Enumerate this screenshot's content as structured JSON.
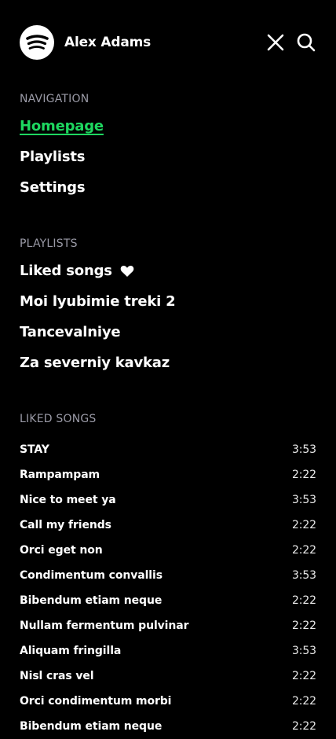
{
  "header": {
    "username": "Alex Adams",
    "logo_icon": "spotify-logo",
    "close_icon": "close-icon",
    "search_icon": "search-icon"
  },
  "navigation": {
    "label": "NAVIGATION",
    "items": [
      {
        "label": "Homepage",
        "active": true
      },
      {
        "label": "Playlists",
        "active": false
      },
      {
        "label": "Settings",
        "active": false
      }
    ]
  },
  "playlists": {
    "label": "PLAYLISTS",
    "items": [
      {
        "label": "Liked songs",
        "icon": "heart-icon"
      },
      {
        "label": "Moi lyubimie treki 2"
      },
      {
        "label": "Tancevalniye"
      },
      {
        "label": "Za severniy kavkaz"
      }
    ]
  },
  "liked_songs": {
    "label": "LIKED SONGS",
    "songs": [
      {
        "title": "STAY",
        "duration": "3:53"
      },
      {
        "title": "Rampampam",
        "duration": "2:22"
      },
      {
        "title": "Nice to meet ya",
        "duration": "3:53"
      },
      {
        "title": "Call my friends",
        "duration": "2:22"
      },
      {
        "title": "Orci eget non",
        "duration": "2:22"
      },
      {
        "title": "Condimentum convallis",
        "duration": "3:53"
      },
      {
        "title": "Bibendum etiam neque",
        "duration": "2:22"
      },
      {
        "title": "Nullam fermentum pulvinar",
        "duration": "2:22"
      },
      {
        "title": "Aliquam fringilla",
        "duration": "3:53"
      },
      {
        "title": "Nisl cras vel",
        "duration": "2:22"
      },
      {
        "title": "Orci condimentum morbi",
        "duration": "2:22"
      },
      {
        "title": "Bibendum etiam neque",
        "duration": "2:22"
      }
    ]
  },
  "colors": {
    "background": "#000000",
    "accent": "#1ed760",
    "section_label": "#9a9aa6"
  }
}
